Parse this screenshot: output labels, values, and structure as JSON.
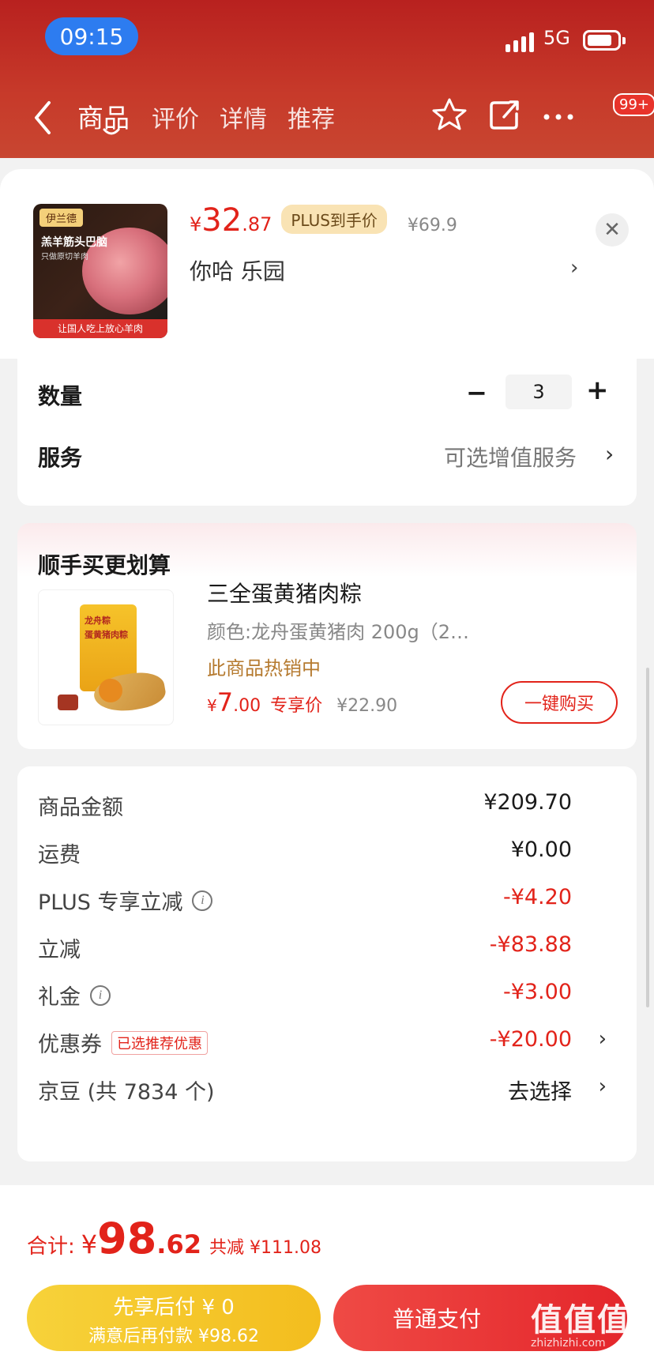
{
  "status_bar": {
    "time": "09:15",
    "network": "5G"
  },
  "nav": {
    "tabs": [
      "商品",
      "评价",
      "详情",
      "推荐"
    ],
    "active_tab": "商品",
    "badge": "99+"
  },
  "product": {
    "thumbnail": {
      "brand": "伊兰德",
      "title": "羔羊筋头巴脑",
      "subtitle": "只做原切羊肉",
      "footer": "让国人吃上放心羊肉"
    },
    "price": {
      "yen": "¥",
      "int": "32",
      "dec": ".87"
    },
    "plus_tag": "PLUS到手价",
    "orig_price": "¥69.9",
    "spec": "你哈  乐园"
  },
  "quantity": {
    "label": "数量",
    "value": "3"
  },
  "service": {
    "label": "服务",
    "value": "可选增值服务"
  },
  "recommend": {
    "title": "顺手买更划算",
    "image": {
      "brand_text": "龙舟粽",
      "bag_text": "蛋黄猪肉粽"
    },
    "name": "三全蛋黄猪肉粽",
    "spec": "颜色:龙舟蛋黄猪肉 200g（2…",
    "hot": "此商品热销中",
    "price": {
      "yen": "¥",
      "int": "7",
      "dec": ".00"
    },
    "exclusive": "专享价",
    "orig_price": "¥22.90",
    "buy_label": "一键购买"
  },
  "fees": [
    {
      "label": "商品金额",
      "value": "¥209.70",
      "color": "normal"
    },
    {
      "label": "运费",
      "value": "¥0.00",
      "color": "normal"
    },
    {
      "label": "PLUS 专享立减",
      "value": "-¥4.20",
      "color": "red",
      "info": true
    },
    {
      "label": "立减",
      "value": "-¥83.88",
      "color": "red"
    },
    {
      "label": "礼金",
      "value": "-¥3.00",
      "color": "red",
      "info": true
    },
    {
      "label": "优惠券",
      "value": "-¥20.00",
      "color": "red",
      "tag": "已选推荐优惠",
      "arrow": true
    },
    {
      "label": "京豆 (共 7834 个)",
      "value": "去选择",
      "color": "normal",
      "arrow": true
    }
  ],
  "total": {
    "label": "合计:",
    "yen": "¥",
    "int": "98",
    "dec": ".62",
    "saved": "共减 ¥111.08"
  },
  "pay_later": {
    "line1": "先享后付 ¥ 0",
    "line2": "满意后再付款 ¥98.62"
  },
  "pay_normal": {
    "label": "普通支付"
  },
  "watermark": {
    "main": "值值值",
    "sub": "zhizhizhi.com"
  },
  "colors": {
    "accent": "#e2231a",
    "header": "#c73a2a",
    "pay_later": "#f5c92c"
  }
}
